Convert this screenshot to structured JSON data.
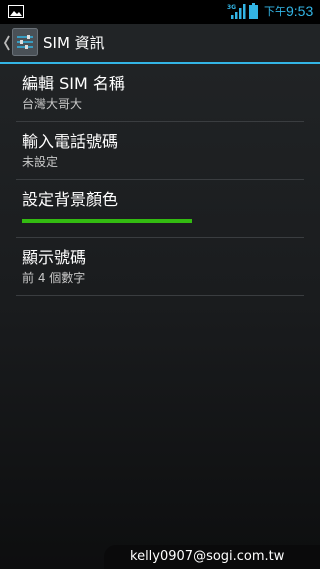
{
  "status_bar": {
    "network": "3G",
    "ampm": "下午",
    "time": "9:53"
  },
  "action_bar": {
    "title": "SIM 資訊"
  },
  "preferences": [
    {
      "title": "編輯 SIM 名稱",
      "summary": "台灣大哥大"
    },
    {
      "title": "輸入電話號碼",
      "summary": "未設定"
    },
    {
      "title": "設定背景顏色",
      "color": "#33bb11"
    },
    {
      "title": "顯示號碼",
      "summary": "前 4 個數字"
    }
  ],
  "watermark": "kelly0907@sogi.com.tw",
  "colors": {
    "accent": "#33b5e5",
    "status_bar_bg": "#000000",
    "sim_color": "#33bb11"
  }
}
